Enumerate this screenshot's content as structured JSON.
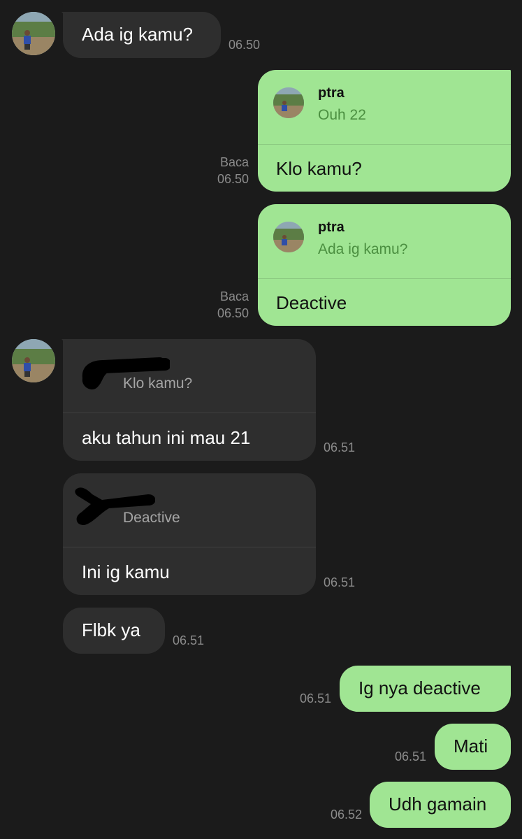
{
  "messages": {
    "m1": {
      "text": "Ada ig kamu?",
      "time": "06.50"
    },
    "m2": {
      "reply_name": "ptra",
      "reply_quote": "Ouh 22",
      "text": "Klo kamu?",
      "status": "Baca",
      "time": "06.50"
    },
    "m3": {
      "reply_name": "ptra",
      "reply_quote": "Ada ig kamu?",
      "text": "Deactive",
      "status": "Baca",
      "time": "06.50"
    },
    "m4": {
      "reply_quote": "Klo kamu?",
      "text": "aku tahun ini mau 21",
      "time": "06.51"
    },
    "m5": {
      "reply_quote": "Deactive",
      "text": "Ini ig kamu",
      "time": "06.51"
    },
    "m6": {
      "text": "Flbk ya",
      "time": "06.51"
    },
    "m7": {
      "text": "Ig nya deactive",
      "time": "06.51"
    },
    "m8": {
      "text": "Mati",
      "time": "06.51"
    },
    "m9": {
      "text": "Udh gamain",
      "time": "06.52"
    }
  },
  "colors": {
    "background": "#1b1b1b",
    "incoming_bubble": "#2e2e2e",
    "outgoing_bubble": "#a0e593",
    "timestamp": "#8b8b8b",
    "reply_quote_out": "#4b8f40"
  },
  "icons": {
    "avatar": "avatar",
    "redaction": "redaction-scribble"
  }
}
